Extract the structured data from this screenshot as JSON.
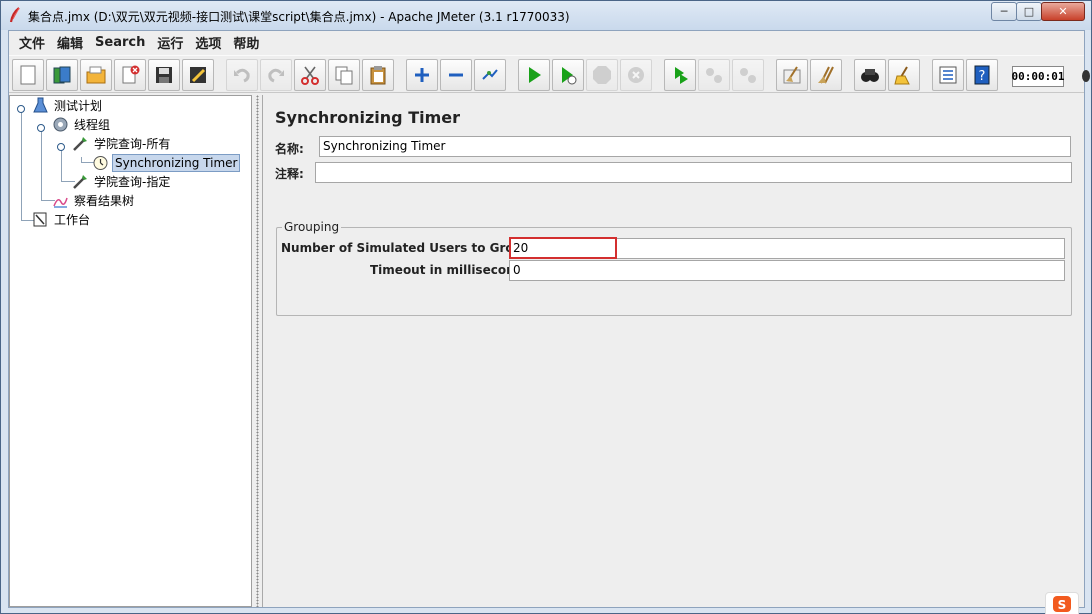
{
  "window": {
    "title": "集合点.jmx (D:\\双元\\双元视频-接口测试\\课堂script\\集合点.jmx) - Apache JMeter (3.1 r1770033)",
    "minimize": "─",
    "maximize": "□",
    "close": "✕"
  },
  "menu": [
    "文件",
    "编辑",
    "Search",
    "运行",
    "选项",
    "帮助"
  ],
  "toolbar": {
    "icons": [
      "new-icon",
      "templates-icon",
      "open-icon",
      "close-file-icon",
      "save-icon",
      "save-screenshot-icon",
      "undo-icon",
      "redo-icon",
      "cut-icon",
      "copy-icon",
      "paste-icon",
      "expand-icon",
      "collapse-icon",
      "toggle-icon",
      "start-icon",
      "start-no-timers-icon",
      "stop-icon",
      "shutdown-icon",
      "remote-start-icon",
      "remote-stop-icon",
      "remote-shutdown-icon",
      "clear-icon",
      "clear-all-icon",
      "search-icon",
      "reset-search-icon",
      "function-helper-icon",
      "help-icon"
    ],
    "timer": "00:00:01"
  },
  "tree": {
    "nodes": [
      {
        "label": "测试计划",
        "icon": "test-plan-icon"
      },
      {
        "label": "线程组",
        "icon": "thread-group-icon"
      },
      {
        "label": "学院查询-所有",
        "icon": "http-sampler-icon"
      },
      {
        "label": "Synchronizing Timer",
        "icon": "timer-icon"
      },
      {
        "label": "学院查询-指定",
        "icon": "http-sampler-icon"
      },
      {
        "label": "察看结果树",
        "icon": "results-tree-icon"
      },
      {
        "label": "工作台",
        "icon": "workbench-icon"
      }
    ]
  },
  "panel": {
    "title": "Synchronizing Timer",
    "name_label": "名称:",
    "name_value": "Synchronizing Timer",
    "comment_label": "注释:",
    "comment_value": "",
    "group_legend": "Grouping",
    "users_label": "Number of Simulated Users to Group by:",
    "users_value": "20",
    "timeout_label": "Timeout in milliseconds:",
    "timeout_value": "0"
  },
  "colors": {
    "selection": "#c7d7ec",
    "highlight": "#d32f2f"
  }
}
